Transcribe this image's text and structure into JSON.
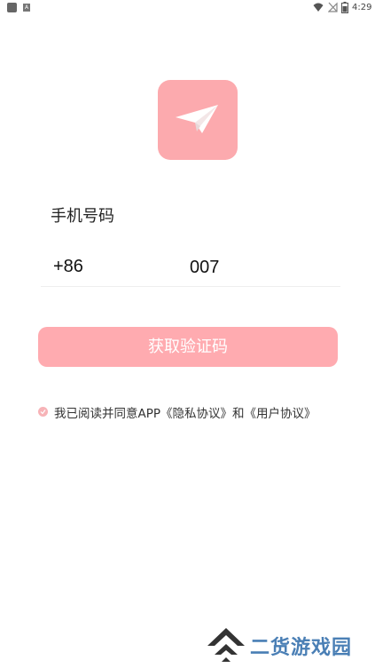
{
  "status_bar": {
    "time": "4:29",
    "small_icon_letter": "A",
    "icons": [
      "app-notification-icon",
      "text-notification-icon",
      "wifi-icon",
      "no-signal-icon",
      "battery-icon"
    ]
  },
  "logo": {
    "icon": "paper-plane-icon",
    "background_color": "#fcaaae"
  },
  "form": {
    "phone_label": "手机号码",
    "country_code": "+86",
    "phone_value": "007",
    "submit_label": "获取验证码",
    "accent_color": "#ffabb0"
  },
  "agreement": {
    "text": "我已阅读并同意APP《隐私协议》和《用户协议》",
    "checked": true
  },
  "watermark": {
    "text": "二货游戏园"
  }
}
